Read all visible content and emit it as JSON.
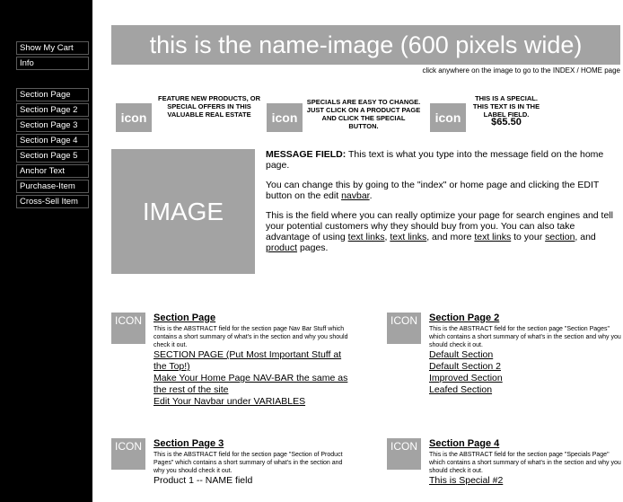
{
  "sidebar": {
    "cart_buttons": [
      "Show My Cart",
      "Info"
    ],
    "nav_buttons": [
      "Section Page",
      "Section Page 2",
      "Section Page 3",
      "Section Page 4",
      "Section Page 5",
      "Anchor Text",
      "Purchase-Item",
      "Cross-Sell Item"
    ]
  },
  "header": {
    "name_image_text": "this is the name-image (600 pixels wide)",
    "hint": "click anywhere on the image to go to the INDEX / HOME page"
  },
  "features": [
    {
      "icon": "icon",
      "text": "FEATURE NEW PRODUCTS, OR SPECIAL OFFERS IN THIS VALUABLE REAL ESTATE"
    },
    {
      "icon": "icon",
      "text": "SPECIALS ARE EASY TO CHANGE. JUST CLICK ON A PRODUCT PAGE AND CLICK THE SPECIAL BUTTON."
    },
    {
      "icon": "icon",
      "text": "THIS IS A SPECIAL. THIS TEXT IS IN THE LABEL FIELD.",
      "price": "$65.50"
    }
  ],
  "main_image": {
    "text": "IMAGE"
  },
  "message": {
    "label": "MESSAGE FIELD:",
    "p1": "This text is what you type into the message field on the home page.",
    "p2_pre": "You can change this by going to the \"index\" or home page and clicking the EDIT button on the edit ",
    "p2_link": "navbar",
    "p2_post": ".",
    "p3_pre": "This is the field where you can really optimize your page for search engines and tell your potential customers why they should buy from you. You can also take advantage of using ",
    "link1": "text links",
    "sep1": ", ",
    "link2": "text links",
    "sep2": ", and more ",
    "link3": "text links",
    "sep3": " to your ",
    "link4": "section",
    "sep4": ", and ",
    "link5": "product",
    "p3_post": " pages."
  },
  "sections": [
    {
      "icon": "ICON",
      "title": "Section Page",
      "abstract": "This is the ABSTRACT field for the section page Nav Bar Stuff which contains a short summary of what's in the section and why you should check it out.",
      "links": [
        "SECTION PAGE (Put Most Important Stuff at the Top!)",
        "Make Your Home Page NAV-BAR the same as the rest of the site",
        "Edit Your Navbar under VARIABLES"
      ]
    },
    {
      "icon": "ICON",
      "title": "Section Page 2",
      "abstract": "This is the ABSTRACT field for the section page \"Section Pages\" which contains a short summary of what's in the section and why you should check it out.",
      "links": [
        "Default Section",
        "Default Section 2",
        "Improved Section",
        "Leafed Section"
      ]
    },
    {
      "icon": "ICON",
      "title": "Section Page 3",
      "abstract": "This is the ABSTRACT field for the section page \"Section of Product Pages\" which contains a short summary of what's in the section and why you should check it out.",
      "links": [
        "Product 1 -- NAME field"
      ]
    },
    {
      "icon": "ICON",
      "title": "Section Page 4",
      "abstract": "This is the ABSTRACT field for the section page \"Specials Page\" which contains a short summary of what's in the section and why you should check it out.",
      "links": [
        "This is Special #2"
      ]
    }
  ]
}
